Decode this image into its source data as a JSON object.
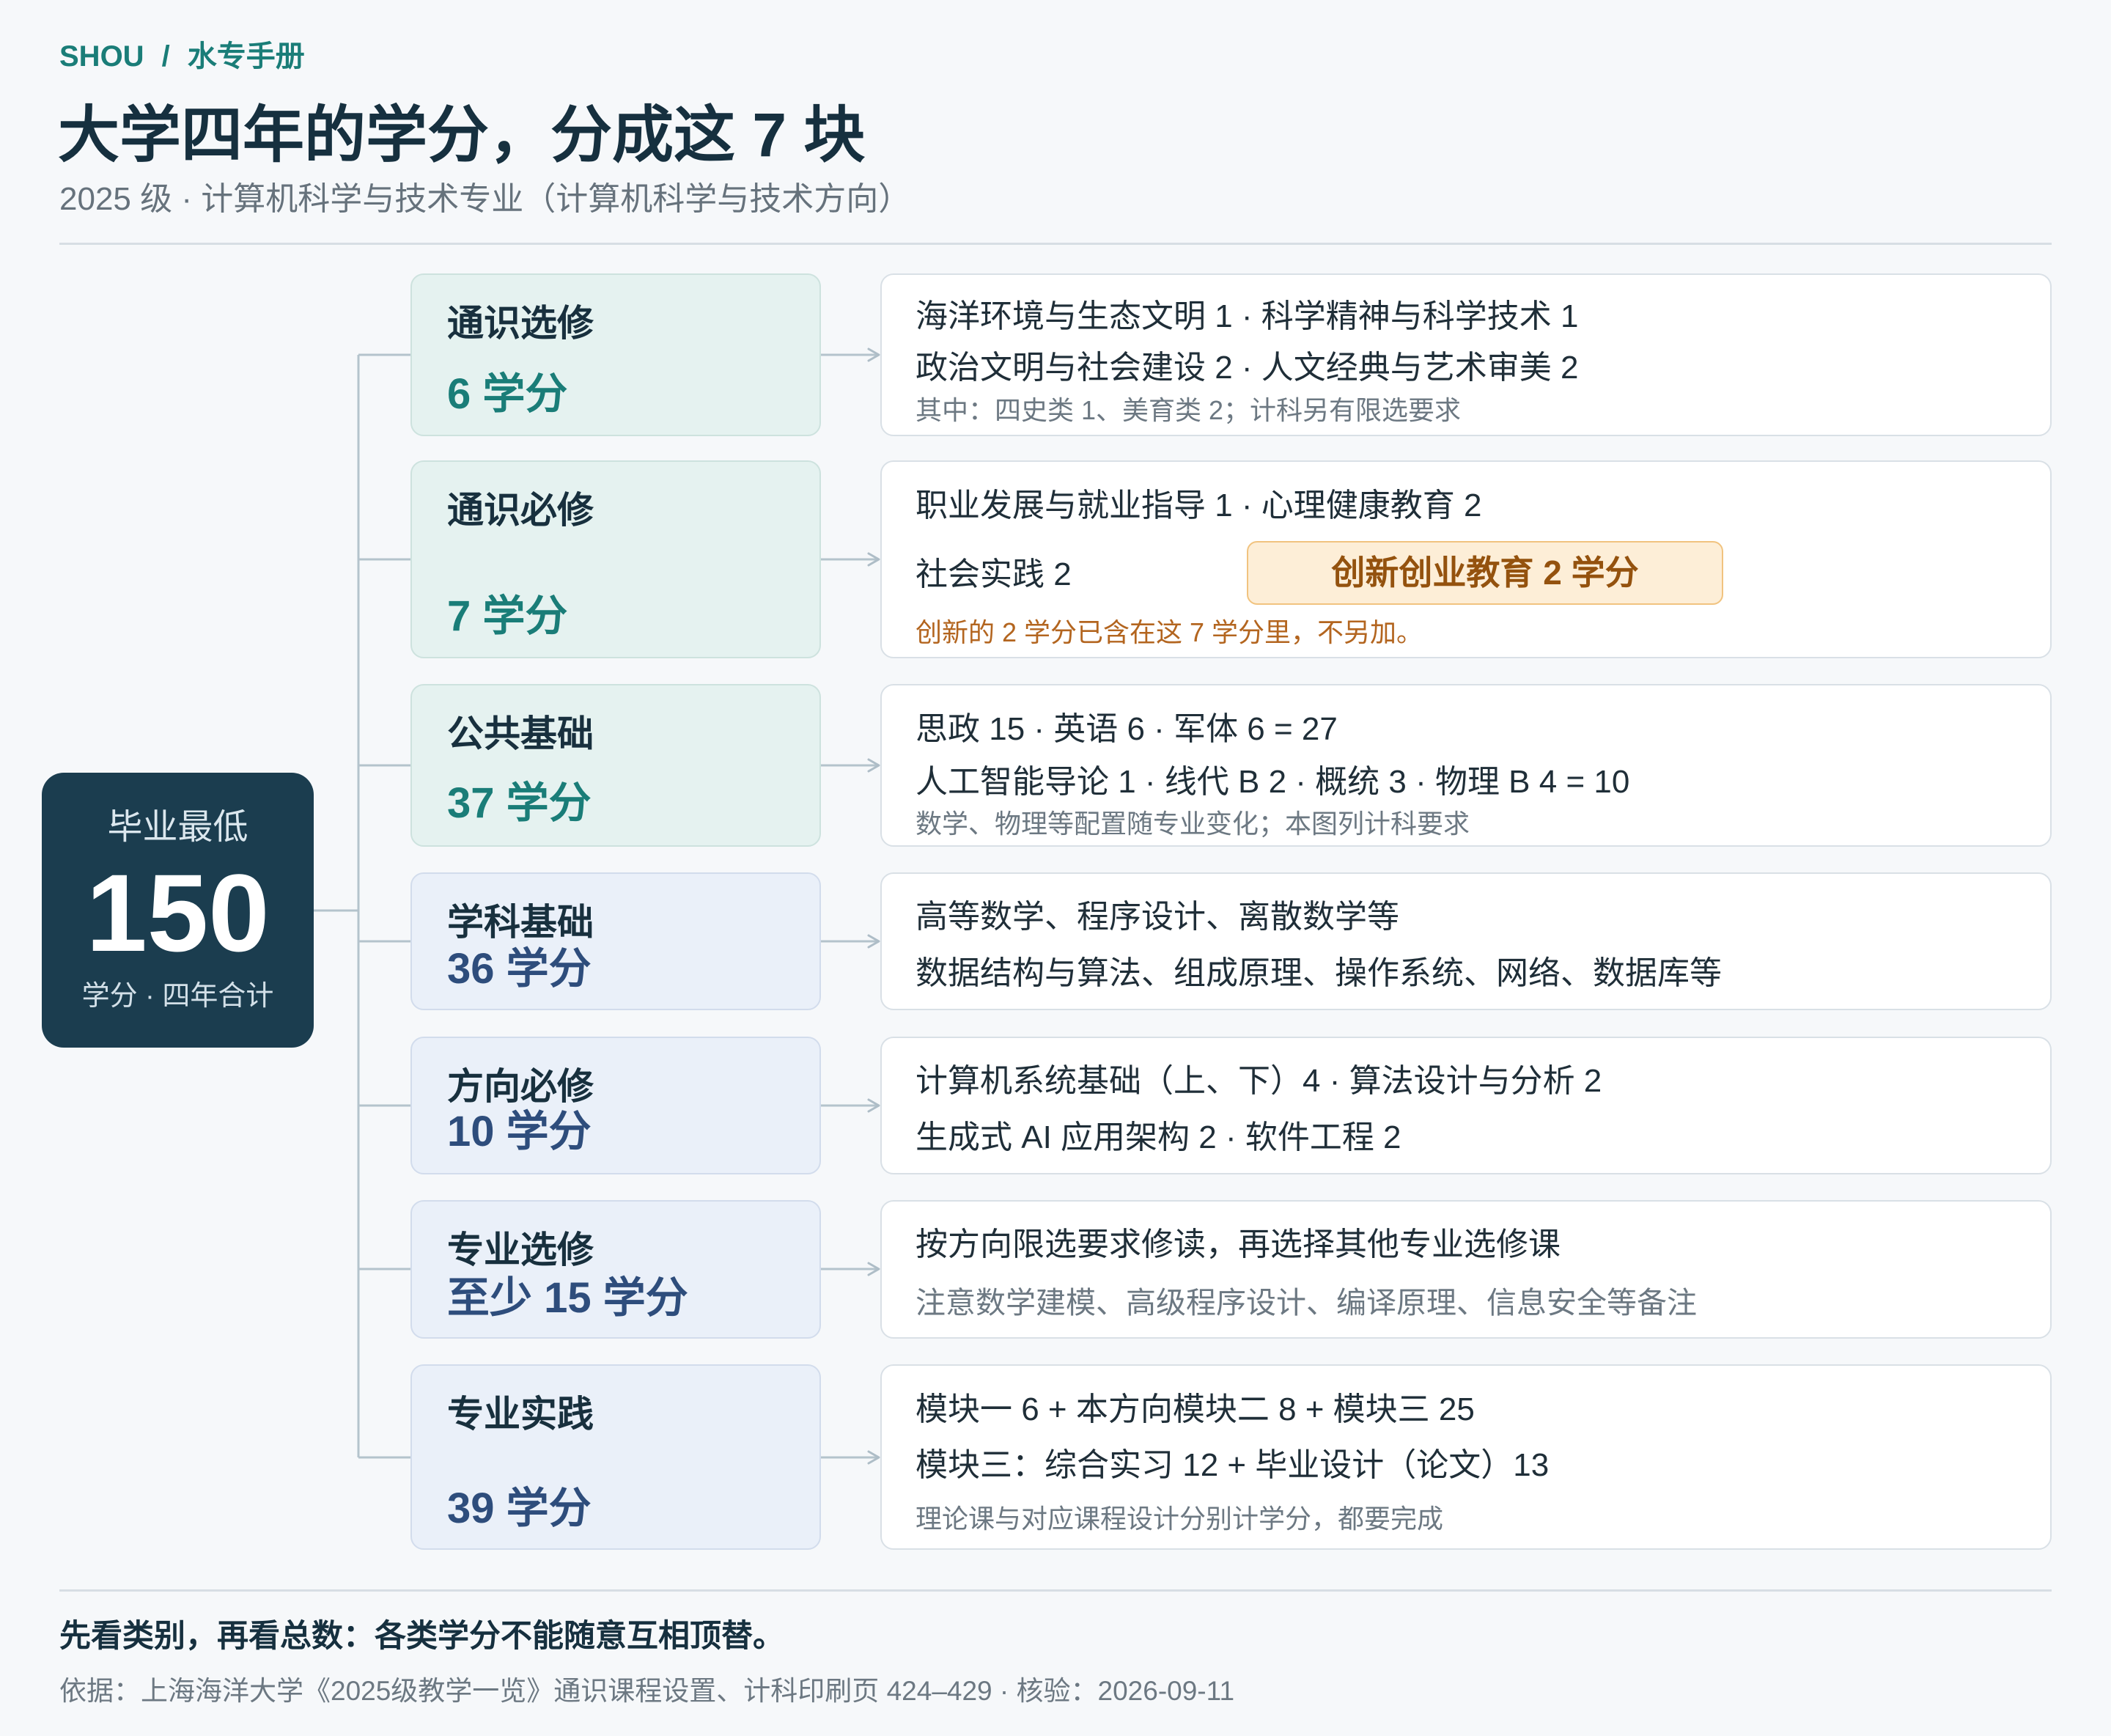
{
  "brand": {
    "org": "SHOU",
    "sep": "/",
    "name": "水专手册"
  },
  "title": "大学四年的学分，分成这 7 块",
  "subtitle": "2025 级 · 计算机科学与技术专业（计算机科学与技术方向）",
  "total": {
    "label": "毕业最低",
    "value": "150",
    "unit": "学分 · 四年合计"
  },
  "categories": [
    {
      "name": "通识选修",
      "credits": "6 学分",
      "lines": [
        "海洋环境与生态文明 1 · 科学精神与科学技术 1",
        "政治文明与社会建设 2 · 人文经典与艺术审美 2"
      ],
      "note": "其中：四史类 1、美育类 2；计科另有限选要求"
    },
    {
      "name": "通识必修",
      "credits": "7 学分",
      "lines": [
        "职业发展与就业指导 1 · 心理健康教育 2",
        "社会实践 2"
      ],
      "highlight": "创新创业教育 2 学分",
      "note": "创新的 2 学分已含在这 7 学分里，不另加。"
    },
    {
      "name": "公共基础",
      "credits": "37 学分",
      "lines": [
        "思政 15 · 英语 6 · 军体 6 = 27",
        "人工智能导论 1 · 线代 B 2 · 概统 3 · 物理 B 4 = 10"
      ],
      "note": "数学、物理等配置随专业变化；本图列计科要求"
    },
    {
      "name": "学科基础",
      "credits": "36 学分",
      "lines": [
        "高等数学、程序设计、离散数学等",
        "数据结构与算法、组成原理、操作系统、网络、数据库等"
      ]
    },
    {
      "name": "方向必修",
      "credits": "10 学分",
      "lines": [
        "计算机系统基础（上、下）4 · 算法设计与分析 2",
        "生成式 AI 应用架构 2 · 软件工程 2"
      ]
    },
    {
      "name": "专业选修",
      "credits": "至少 15 学分",
      "lines": [
        "按方向限选要求修读，再选择其他专业选修课"
      ],
      "note": "注意数学建模、高级程序设计、编译原理、信息安全等备注"
    },
    {
      "name": "专业实践",
      "credits": "39 学分",
      "lines": [
        "模块一 6 + 本方向模块二 8 + 模块三 25",
        "模块三：综合实习 12 + 毕业设计（论文）13"
      ],
      "note": "理论课与对应课程设计分别计学分，都要完成"
    }
  ],
  "footer": {
    "takeaway": "先看类别，再看总数：各类学分不能随意互相顶替。",
    "source": "依据：上海海洋大学《2025级教学一览》通识课程设置、计科印刷页 424–429 · 核验：2026-09-11"
  },
  "colors": {
    "accent": "#1a7d78",
    "navy": "#1b3d4f",
    "blue": "#2e4d7c",
    "highlight": "#94520e",
    "warning": "#b3651f"
  }
}
